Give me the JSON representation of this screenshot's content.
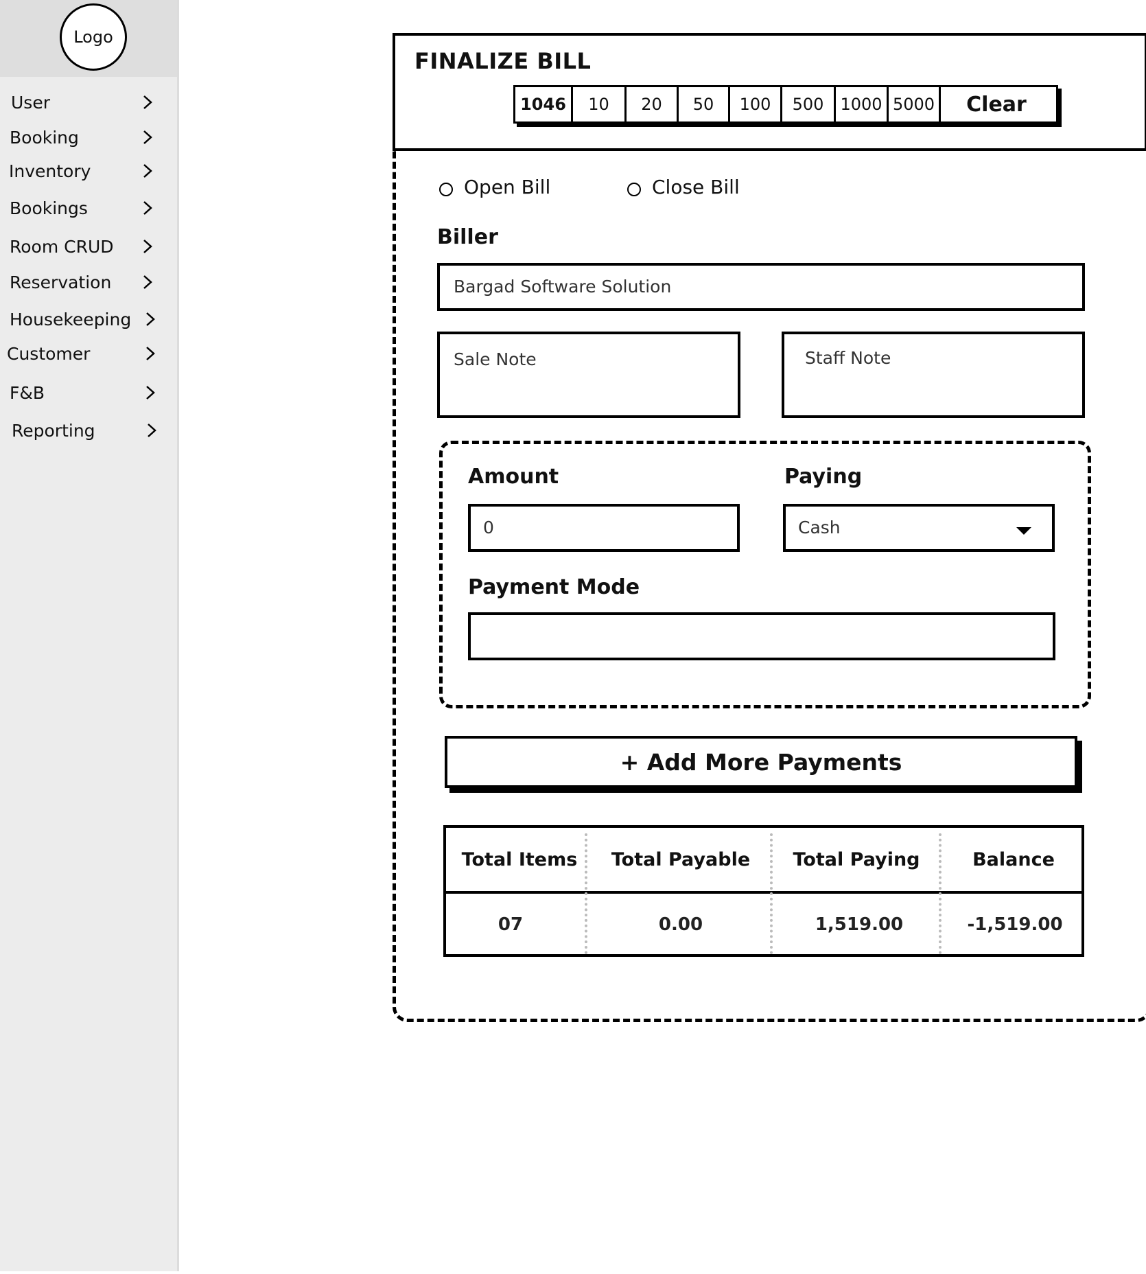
{
  "sidebar": {
    "logo": "Logo",
    "items": [
      {
        "label": "User"
      },
      {
        "label": "Booking"
      },
      {
        "label": "Inventory"
      },
      {
        "label": "Bookings"
      },
      {
        "label": "Room CRUD"
      },
      {
        "label": "Reservation"
      },
      {
        "label": "Housekeeping"
      },
      {
        "label": "Customer"
      },
      {
        "label": "F&B"
      },
      {
        "label": "Reporting"
      }
    ],
    "chevron_icon": "chevron-right-icon"
  },
  "header": {
    "title": "FINALIZE BILL",
    "denominations": [
      "1046",
      "10",
      "20",
      "50",
      "100",
      "500",
      "1000",
      "5000"
    ],
    "clear_label": "Clear"
  },
  "bill_type": {
    "options": [
      {
        "label": "Open Bill",
        "selected": false
      },
      {
        "label": "Close Bill",
        "selected": false
      }
    ]
  },
  "biller": {
    "label": "Biller",
    "value": "Bargad Software Solution"
  },
  "notes": {
    "sale_note_placeholder": "Sale Note",
    "staff_note_placeholder": "Staff Note"
  },
  "payment": {
    "amount_label": "Amount",
    "amount_value": "0",
    "paying_label": "Paying",
    "paying_value": "Cash",
    "payment_mode_label": "Payment Mode",
    "payment_mode_value": ""
  },
  "add_payment_label": "+ Add More Payments",
  "summary": {
    "headers": [
      "Total Items",
      "Total Payable",
      "Total Paying",
      "Balance"
    ],
    "values": [
      "07",
      "0.00",
      "1,519.00",
      "-1,519.00"
    ]
  }
}
